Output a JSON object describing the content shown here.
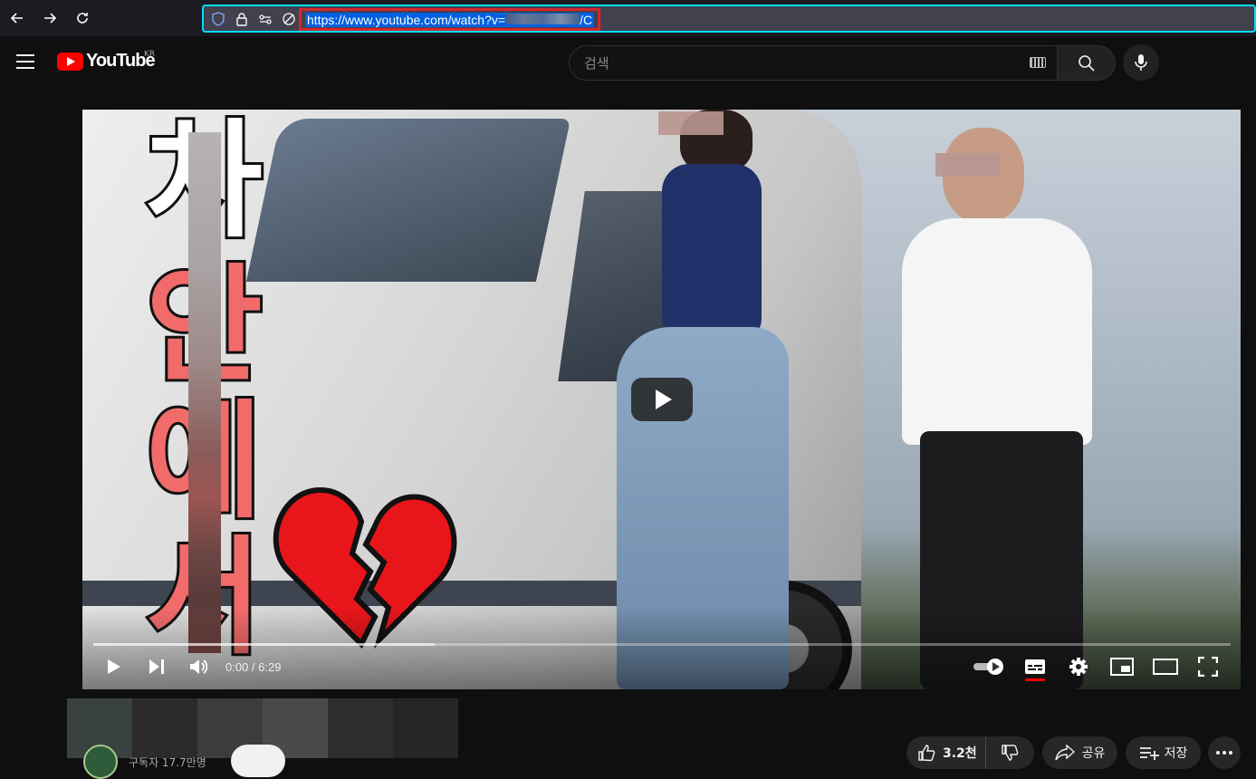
{
  "browser": {
    "url_start": "https://www.youtube.com/watch?v",
    "url_end": "/C"
  },
  "masthead": {
    "logo_text": "YouTube",
    "region": "KR",
    "search_placeholder": "검색"
  },
  "player": {
    "thumbnail_text": [
      "차",
      "안",
      "에",
      "서"
    ],
    "time_display": "0:00 / 6:29",
    "progress_loaded_fraction": 0.3,
    "autoplay": "on",
    "captions": "on"
  },
  "channel": {
    "subscribers": "구독자 17.7만명"
  },
  "actions": {
    "like_count": "3.2천",
    "share_label": "공유",
    "save_label": "저장"
  },
  "colors": {
    "accent_red": "#ff0000",
    "url_highlight": "#d7262b",
    "url_focus": "#00ddff"
  }
}
